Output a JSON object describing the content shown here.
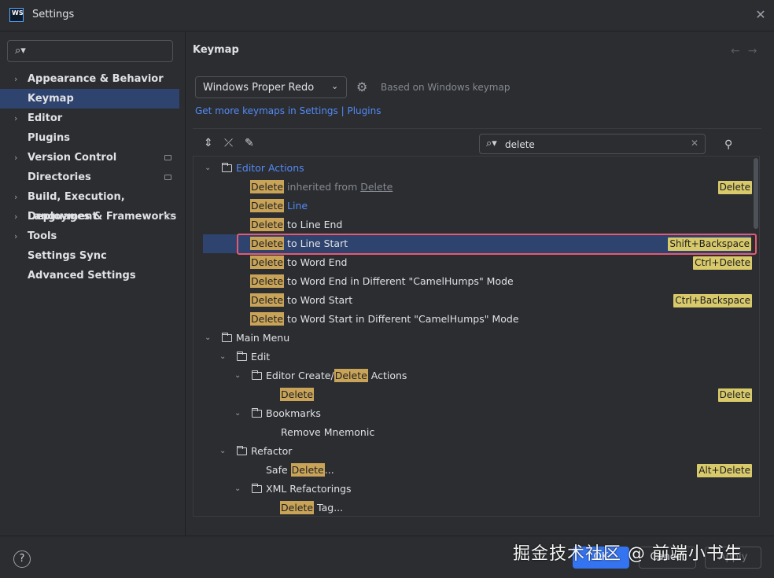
{
  "window": {
    "title": "Settings",
    "app_icon": "WS"
  },
  "sidebar": {
    "search_placeholder": "",
    "items": [
      {
        "label": "Appearance & Behavior",
        "expandable": true,
        "badge": false
      },
      {
        "label": "Keymap",
        "expandable": false,
        "badge": false,
        "selected": true
      },
      {
        "label": "Editor",
        "expandable": true,
        "badge": false
      },
      {
        "label": "Plugins",
        "expandable": false,
        "badge": false
      },
      {
        "label": "Version Control",
        "expandable": true,
        "badge": true
      },
      {
        "label": "Directories",
        "expandable": false,
        "badge": true
      },
      {
        "label": "Build, Execution, Deployment",
        "expandable": true,
        "badge": false
      },
      {
        "label": "Languages & Frameworks",
        "expandable": true,
        "badge": true
      },
      {
        "label": "Tools",
        "expandable": true,
        "badge": false
      },
      {
        "label": "Settings Sync",
        "expandable": false,
        "badge": false
      },
      {
        "label": "Advanced Settings",
        "expandable": false,
        "badge": false
      }
    ]
  },
  "main": {
    "heading": "Keymap",
    "keymap_select": "Windows Proper Redo",
    "based_on": "Based on Windows keymap",
    "link": "Get more keymaps in Settings | Plugins",
    "filter_value": "delete",
    "tree": {
      "editor_actions": "Editor Actions",
      "r1_hl": "Delete",
      "r1_a": " inherited from ",
      "r1_b": "Delete",
      "r1_sc": "Delete",
      "r2_hl": "Delete",
      "r2_a": " Line",
      "r3_hl": "Delete",
      "r3_a": " to Line End",
      "r4_hl": "Delete",
      "r4_a": " to Line Start",
      "r4_sc": "Shift+Backspace",
      "r5_hl": "Delete",
      "r5_a": " to Word End",
      "r5_sc": "Ctrl+Delete",
      "r6_hl": "Delete",
      "r6_a": " to Word End in Different \"CamelHumps\" Mode",
      "r7_hl": "Delete",
      "r7_a": " to Word Start",
      "r7_sc": "Ctrl+Backspace",
      "r8_hl": "Delete",
      "r8_a": " to Word Start in Different \"CamelHumps\" Mode",
      "main_menu": "Main Menu",
      "edit": "Edit",
      "ecda_a": "Editor Create/",
      "ecda_hl": "Delete",
      "ecda_b": " Actions",
      "r9_hl": "Delete",
      "r9_sc": "Delete",
      "bookmarks": "Bookmarks",
      "remove_mnemonic": "Remove Mnemonic",
      "refactor": "Refactor",
      "safe_a": "Safe ",
      "safe_hl": "Delete",
      "safe_b": "...",
      "safe_sc": "Alt+Delete",
      "xml_ref": "XML Refactorings",
      "tag_hl": "Delete",
      "tag_b": " Tag..."
    }
  },
  "footer": {
    "help": "?",
    "ok": "OK",
    "cancel": "Cancel",
    "apply": "Apply",
    "watermark": "掘金技术社区 @ 前端小书生"
  }
}
